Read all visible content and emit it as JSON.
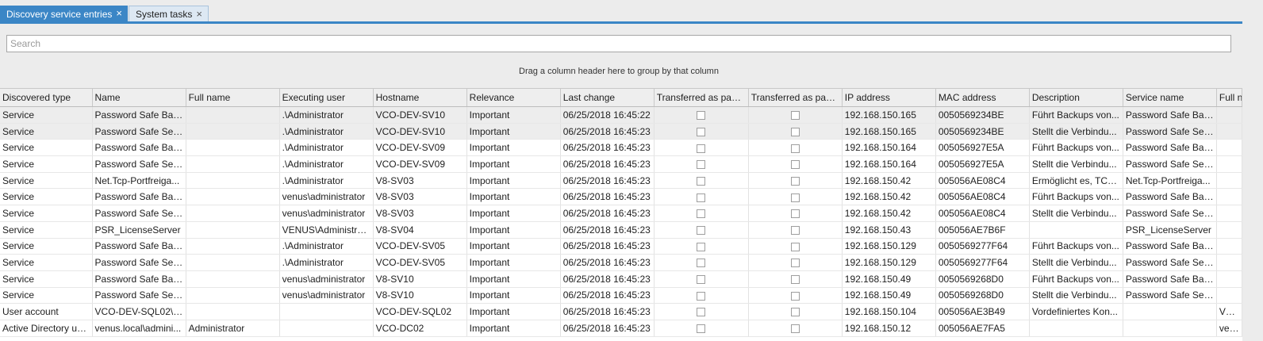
{
  "tabs": [
    {
      "label": "Discovery service entries",
      "active": true
    },
    {
      "label": "System tasks",
      "active": false
    }
  ],
  "tab_close_glyph": "×",
  "search": {
    "placeholder": "Search",
    "value": ""
  },
  "group_hint": "Drag a column header here to group by that column",
  "colors": {
    "accent": "#3b86c6",
    "inactive_tab": "#dde8f3"
  },
  "columns": [
    "Discovered type",
    "Name",
    "Full name",
    "Executing user",
    "Hostname",
    "Relevance",
    "Last change",
    "Transferred as pass...",
    "Transferred as pass...",
    "IP address",
    "MAC address",
    "Description",
    "Service name",
    "Full n"
  ],
  "rows": [
    [
      "Service",
      "Password Safe Bac...",
      "",
      ".\\Administrator",
      "VCO-DEV-SV10",
      "Important",
      "06/25/2018 16:45:22",
      false,
      false,
      "192.168.150.165",
      "0050569234BE",
      "Führt Backups von...",
      "Password Safe Bac...",
      ""
    ],
    [
      "Service",
      "Password Safe Serv...",
      "",
      ".\\Administrator",
      "VCO-DEV-SV10",
      "Important",
      "06/25/2018 16:45:23",
      false,
      false,
      "192.168.150.165",
      "0050569234BE",
      "Stellt die Verbindu...",
      "Password Safe Serv...",
      ""
    ],
    [
      "Service",
      "Password Safe Bac...",
      "",
      ".\\Administrator",
      "VCO-DEV-SV09",
      "Important",
      "06/25/2018 16:45:23",
      false,
      false,
      "192.168.150.164",
      "005056927E5A",
      "Führt Backups von...",
      "Password Safe Bac...",
      ""
    ],
    [
      "Service",
      "Password Safe Serv...",
      "",
      ".\\Administrator",
      "VCO-DEV-SV09",
      "Important",
      "06/25/2018 16:45:23",
      false,
      false,
      "192.168.150.164",
      "005056927E5A",
      "Stellt die Verbindu...",
      "Password Safe Serv...",
      ""
    ],
    [
      "Service",
      "Net.Tcp-Portfreiga...",
      "",
      ".\\Administrator",
      "V8-SV03",
      "Important",
      "06/25/2018 16:45:23",
      false,
      false,
      "192.168.150.42",
      "005056AE08C4",
      "Ermöglicht es, TCP...",
      "Net.Tcp-Portfreiga...",
      ""
    ],
    [
      "Service",
      "Password Safe Bac...",
      "",
      "venus\\administrator",
      "V8-SV03",
      "Important",
      "06/25/2018 16:45:23",
      false,
      false,
      "192.168.150.42",
      "005056AE08C4",
      "Führt Backups von...",
      "Password Safe Bac...",
      ""
    ],
    [
      "Service",
      "Password Safe Serv...",
      "",
      "venus\\administrator",
      "V8-SV03",
      "Important",
      "06/25/2018 16:45:23",
      false,
      false,
      "192.168.150.42",
      "005056AE08C4",
      "Stellt die Verbindu...",
      "Password Safe Serv...",
      ""
    ],
    [
      "Service",
      "PSR_LicenseServer",
      "",
      "VENUS\\Administra...",
      "V8-SV04",
      "Important",
      "06/25/2018 16:45:23",
      false,
      false,
      "192.168.150.43",
      "005056AE7B6F",
      "",
      "PSR_LicenseServer",
      ""
    ],
    [
      "Service",
      "Password Safe Bac...",
      "",
      ".\\Administrator",
      "VCO-DEV-SV05",
      "Important",
      "06/25/2018 16:45:23",
      false,
      false,
      "192.168.150.129",
      "0050569277F64",
      "Führt Backups von...",
      "Password Safe Bac...",
      ""
    ],
    [
      "Service",
      "Password Safe Serv...",
      "",
      ".\\Administrator",
      "VCO-DEV-SV05",
      "Important",
      "06/25/2018 16:45:23",
      false,
      false,
      "192.168.150.129",
      "0050569277F64",
      "Stellt die Verbindu...",
      "Password Safe Serv...",
      ""
    ],
    [
      "Service",
      "Password Safe Bac...",
      "",
      "venus\\administrator",
      "V8-SV10",
      "Important",
      "06/25/2018 16:45:23",
      false,
      false,
      "192.168.150.49",
      "0050569268D0",
      "Führt Backups von...",
      "Password Safe Bac...",
      ""
    ],
    [
      "Service",
      "Password Safe Serv...",
      "",
      "venus\\administrator",
      "V8-SV10",
      "Important",
      "06/25/2018 16:45:23",
      false,
      false,
      "192.168.150.49",
      "0050569268D0",
      "Stellt die Verbindu...",
      "Password Safe Serv...",
      ""
    ],
    [
      "User account",
      "VCO-DEV-SQL02\\A...",
      "",
      "",
      "VCO-DEV-SQL02",
      "Important",
      "06/25/2018 16:45:23",
      false,
      false,
      "192.168.150.104",
      "005056AE3B49",
      "Vordefiniertes Kon...",
      "",
      "VCO"
    ],
    [
      "Active Directory user",
      "venus.local\\admini...",
      "Administrator",
      "",
      "VCO-DC02",
      "Important",
      "06/25/2018 16:45:23",
      false,
      false,
      "192.168.150.12",
      "005056AE7FA5",
      "",
      "",
      "venu"
    ]
  ]
}
